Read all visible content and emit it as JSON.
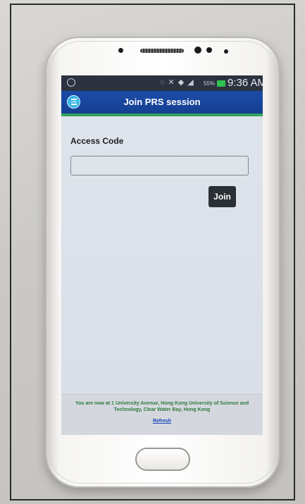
{
  "status_bar": {
    "battery_percent": "55%",
    "time": "9:36 AM",
    "icons": [
      "whatsapp-icon",
      "mute-icon",
      "nfc-icon",
      "wifi-icon",
      "signal-icon",
      "battery-icon"
    ]
  },
  "header": {
    "title": "Join PRS session",
    "menu_icon": "hamburger-menu-icon"
  },
  "form": {
    "access_code_label": "Access Code",
    "access_code_value": "",
    "join_label": "Join"
  },
  "footer": {
    "location_text": "You are now at 1 University Avenue, Hong Kong University of Science and Technology, Clear Water Bay, Hong Kong",
    "refresh_label": "Refresh"
  },
  "colors": {
    "header_bg": "#1b4da8",
    "header_accent": "#33a35a",
    "join_button_bg": "#2b2f36",
    "location_text": "#2f7a3c",
    "refresh_link": "#1a46b8"
  }
}
